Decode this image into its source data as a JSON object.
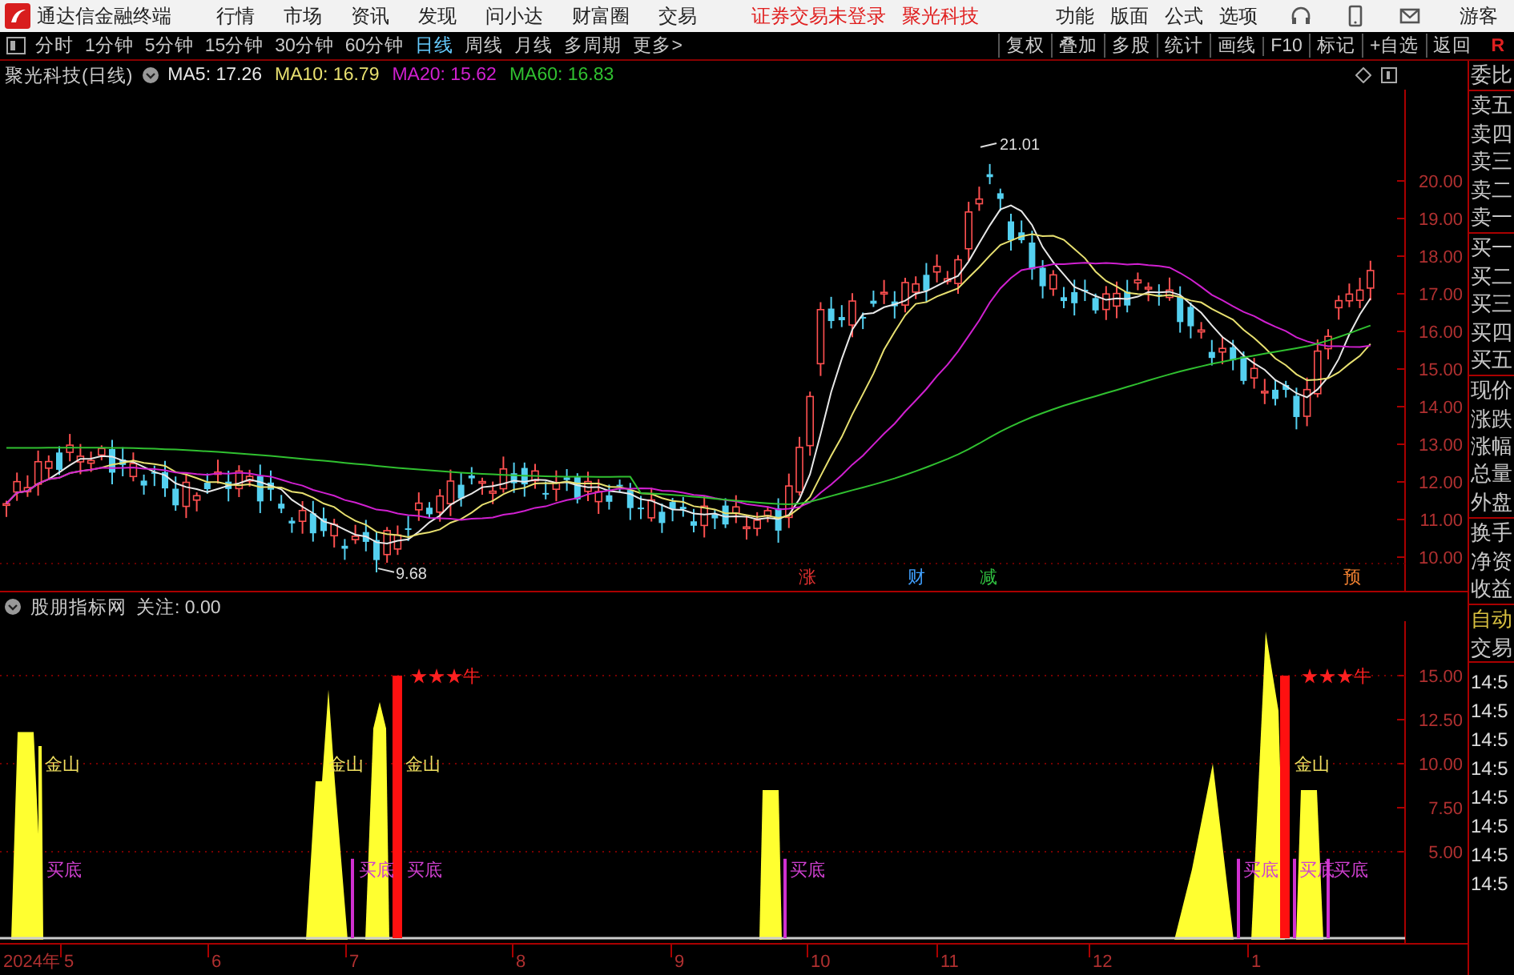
{
  "app_bar": {
    "title": "通达信金融终端",
    "menu": [
      "行情",
      "市场",
      "资讯",
      "发现",
      "问小达",
      "财富圈",
      "交易"
    ],
    "login_status": "证券交易未登录",
    "stock_name": "聚光科技",
    "tools": [
      "功能",
      "版面",
      "公式",
      "选项"
    ],
    "user": "游客"
  },
  "toolbar": {
    "periods": [
      {
        "label": "分时",
        "selected": false
      },
      {
        "label": "1分钟",
        "selected": false
      },
      {
        "label": "5分钟",
        "selected": false
      },
      {
        "label": "15分钟",
        "selected": false
      },
      {
        "label": "30分钟",
        "selected": false
      },
      {
        "label": "60分钟",
        "selected": false
      },
      {
        "label": "日线",
        "selected": true
      },
      {
        "label": "周线",
        "selected": false
      },
      {
        "label": "月线",
        "selected": false
      },
      {
        "label": "多周期",
        "selected": false
      },
      {
        "label": "更多>",
        "selected": false
      }
    ],
    "actions": [
      "复权",
      "叠加",
      "多股",
      "统计",
      "画线",
      "F10",
      "标记",
      "+自选",
      "返回"
    ],
    "badge": "R"
  },
  "main_chart": {
    "title": "聚光科技(日线)",
    "moving_averages": [
      {
        "label": "MA5: 17.26",
        "color": "#e8e8e8"
      },
      {
        "label": "MA10: 16.79",
        "color": "#e8e070"
      },
      {
        "label": "MA20: 15.62",
        "color": "#d020d0"
      },
      {
        "label": "MA60: 16.83",
        "color": "#30c030"
      }
    ],
    "price_ticks": [
      "20.00",
      "19.00",
      "18.00",
      "17.00",
      "16.00",
      "15.00",
      "14.00",
      "13.00",
      "12.00",
      "11.00",
      "10.00"
    ],
    "high_label": "21.01",
    "low_label": "9.68",
    "events": [
      {
        "text": "涨",
        "color": "#e03030"
      },
      {
        "text": "财",
        "color": "#40a0ff"
      },
      {
        "text": "减",
        "color": "#30c040"
      },
      {
        "text": "预",
        "color": "#f08030"
      }
    ]
  },
  "indicator": {
    "title": "股朋指标网",
    "focus": "关注: 0.00",
    "ticks": [
      "15.00",
      "12.50",
      "10.00",
      "7.50",
      "5.00"
    ],
    "signals": [
      {
        "kind": "mountain",
        "text": "金山"
      },
      {
        "kind": "mountain",
        "text": "金山"
      },
      {
        "kind": "mountain",
        "text": "金山"
      },
      {
        "kind": "mountain",
        "text": "金山"
      },
      {
        "kind": "bottom",
        "text": "买底"
      },
      {
        "kind": "bottom",
        "text": "买底"
      },
      {
        "kind": "bottom",
        "text": "买底"
      },
      {
        "kind": "bottom",
        "text": "买底"
      },
      {
        "kind": "bottom",
        "text": "买底"
      },
      {
        "kind": "bottom",
        "text": "买底"
      },
      {
        "kind": "bottom",
        "text": "买底"
      },
      {
        "kind": "bull",
        "text": "★★★牛"
      },
      {
        "kind": "bull",
        "text": "★★★牛"
      }
    ]
  },
  "date_axis": [
    "2024年",
    "5",
    "6",
    "7",
    "8",
    "9",
    "10",
    "11",
    "12",
    "1"
  ],
  "quote_panel": {
    "groups": [
      [
        "委比"
      ],
      [
        "卖五",
        "卖四",
        "卖三",
        "卖二",
        "卖一"
      ],
      [
        "买一",
        "买二",
        "买三",
        "买四",
        "买五"
      ],
      [
        "现价",
        "涨跌",
        "涨幅",
        "总量",
        "外盘"
      ],
      [
        "换手",
        "净资",
        "收益"
      ]
    ],
    "trade_tabs": [
      {
        "label": "自动",
        "selected": true
      },
      {
        "label": "交易",
        "selected": false
      }
    ],
    "tick_times": [
      "14:5",
      "14:5",
      "14:5",
      "14:5",
      "14:5",
      "14:5",
      "14:5",
      "14:5"
    ]
  }
}
